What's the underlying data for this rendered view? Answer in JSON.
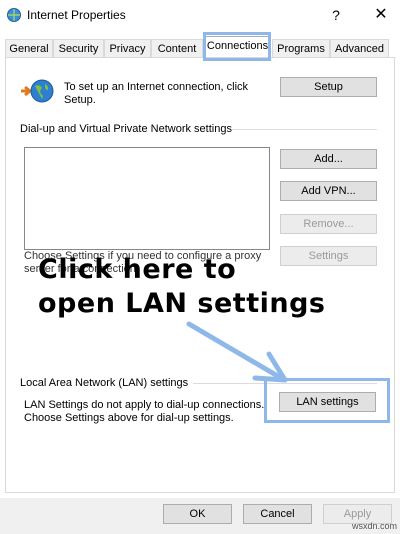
{
  "window": {
    "title": "Internet Properties",
    "help_label": "?",
    "close_label": "✕"
  },
  "tabs": [
    {
      "label": "General"
    },
    {
      "label": "Security"
    },
    {
      "label": "Privacy"
    },
    {
      "label": "Content"
    },
    {
      "label": "Connections",
      "active": true
    },
    {
      "label": "Programs"
    },
    {
      "label": "Advanced"
    }
  ],
  "setup": {
    "text": "To set up an Internet connection, click Setup.",
    "button": "Setup"
  },
  "dialup": {
    "group_label": "Dial-up and Virtual Private Network settings",
    "add_button": "Add...",
    "add_vpn_button": "Add VPN...",
    "remove_button": "Remove...",
    "settings_button": "Settings",
    "proxy_text": "Choose Settings if you need to configure a proxy server for a connection."
  },
  "annotation": {
    "line1": "Click here to",
    "line2": "open LAN settings",
    "color": "#8fb8ea"
  },
  "lan": {
    "group_label": "Local Area Network (LAN) settings",
    "text": "LAN Settings do not apply to dial-up connections. Choose Settings above for dial-up settings.",
    "button": "LAN settings"
  },
  "footer": {
    "ok": "OK",
    "cancel": "Cancel",
    "apply": "Apply"
  },
  "watermark": "wsxdn.com"
}
